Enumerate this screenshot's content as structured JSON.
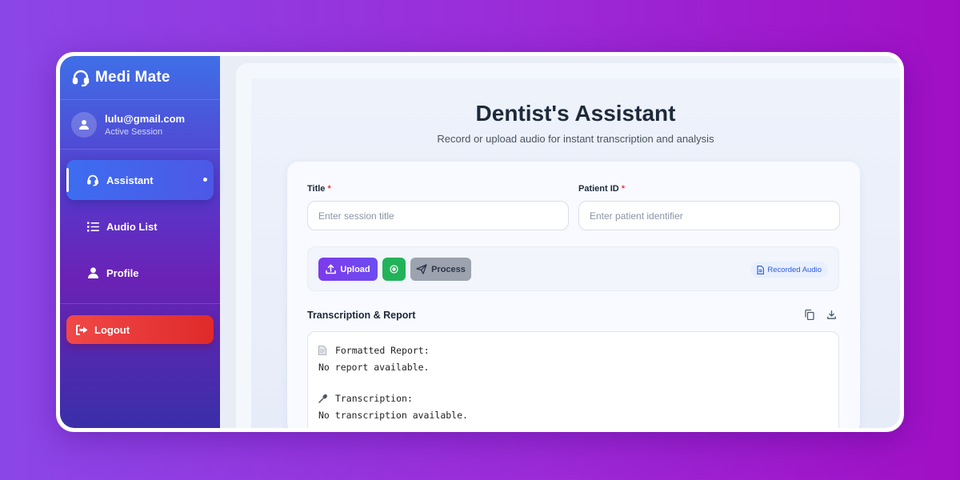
{
  "brand": {
    "name": "Medi Mate"
  },
  "user": {
    "email": "lulu@gmail.com",
    "status": "Active Session"
  },
  "nav": {
    "items": [
      {
        "label": "Assistant",
        "icon": "headset-icon",
        "active": true
      },
      {
        "label": "Audio List",
        "icon": "list-icon",
        "active": false
      },
      {
        "label": "Profile",
        "icon": "user-icon",
        "active": false
      }
    ],
    "logout": "Logout"
  },
  "page": {
    "title": "Dentist's Assistant",
    "subtitle": "Record or upload audio for instant transcription and analysis"
  },
  "form": {
    "title_label": "Title",
    "title_placeholder": "Enter session title",
    "patient_label": "Patient ID",
    "patient_placeholder": "Enter patient identifier",
    "required_mark": "*"
  },
  "toolbar": {
    "upload": "Upload",
    "process": "Process",
    "badge": "Recorded Audio"
  },
  "output": {
    "section_title": "Transcription & Report",
    "report_heading": "Formatted Report:",
    "report_text": "No report available.",
    "transcription_heading": "Transcription:",
    "transcription_text": "No transcription available."
  },
  "colors": {
    "accent": "#7c3aed",
    "record": "#22b35a",
    "logout": "#e53e3e",
    "active_nav": "#3d6df0"
  }
}
